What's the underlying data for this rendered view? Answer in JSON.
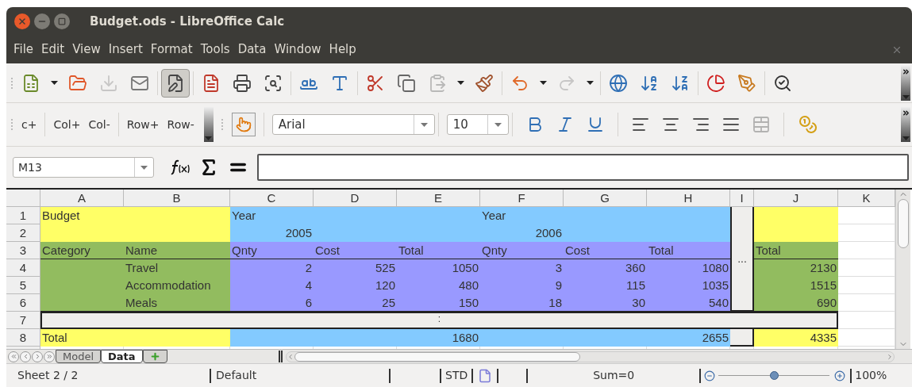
{
  "window": {
    "title": "Budget.ods - LibreOffice Calc"
  },
  "menu": [
    "File",
    "Edit",
    "View",
    "Insert",
    "Format",
    "Tools",
    "Data",
    "Window",
    "Help"
  ],
  "toolbar": [
    {
      "items": [
        {
          "kind": "new",
          "disabled": false,
          "on": false
        },
        {
          "kind": "caret",
          "disabled": false,
          "on": false
        },
        {
          "kind": "open",
          "disabled": false,
          "on": false
        },
        {
          "kind": "save",
          "disabled": true,
          "on": false
        },
        {
          "kind": "mail",
          "disabled": false,
          "on": false
        }
      ]
    },
    {
      "items": [
        {
          "kind": "edit",
          "disabled": false,
          "on": true
        }
      ]
    },
    {
      "items": [
        {
          "kind": "pdf",
          "disabled": false,
          "on": false
        },
        {
          "kind": "print",
          "disabled": false,
          "on": false
        },
        {
          "kind": "preview",
          "disabled": false,
          "on": false
        }
      ]
    },
    {
      "items": [
        {
          "kind": "spell",
          "disabled": false,
          "on": false
        },
        {
          "kind": "autospell",
          "disabled": false,
          "on": false
        }
      ]
    },
    {
      "items": [
        {
          "kind": "cut",
          "disabled": false,
          "on": false
        },
        {
          "kind": "copy",
          "disabled": false,
          "on": false
        },
        {
          "kind": "paste",
          "disabled": true,
          "on": false
        },
        {
          "kind": "caret",
          "disabled": false,
          "on": false
        },
        {
          "kind": "brush",
          "disabled": false,
          "on": false
        }
      ]
    },
    {
      "items": [
        {
          "kind": "undo",
          "disabled": false,
          "on": false
        },
        {
          "kind": "caret",
          "disabled": false,
          "on": false
        },
        {
          "kind": "redo",
          "disabled": true,
          "on": false
        },
        {
          "kind": "caret",
          "disabled": false,
          "on": false
        }
      ]
    },
    {
      "items": [
        {
          "kind": "navigator",
          "disabled": false,
          "on": false
        },
        {
          "kind": "sort-asc",
          "disabled": false,
          "on": false
        },
        {
          "kind": "sort-desc",
          "disabled": false,
          "on": false
        }
      ]
    },
    {
      "items": [
        {
          "kind": "chart",
          "disabled": false,
          "on": false
        },
        {
          "kind": "draw",
          "disabled": false,
          "on": false
        }
      ]
    },
    {
      "items": [
        {
          "kind": "find",
          "disabled": false,
          "on": false
        }
      ]
    }
  ],
  "toolbar2": {
    "groups": [
      [
        "c+"
      ],
      [
        "Col+",
        "Col-"
      ],
      [
        "Row+",
        "Row-"
      ]
    ],
    "font": "Arial",
    "size": "10",
    "format": [
      {
        "kind": "bold",
        "disabled": false
      },
      {
        "kind": "italic",
        "disabled": false
      },
      {
        "kind": "underline",
        "disabled": false
      }
    ],
    "align": [
      {
        "kind": "left",
        "disabled": false
      },
      {
        "kind": "center",
        "disabled": false
      },
      {
        "kind": "right",
        "disabled": false
      },
      {
        "kind": "justify",
        "disabled": false
      },
      {
        "kind": "merge",
        "disabled": true
      }
    ]
  },
  "formula_bar": {
    "cell": "M13"
  },
  "sheet": {
    "columns": [
      "A",
      "B",
      "C",
      "D",
      "E",
      "F",
      "G",
      "H",
      "I",
      "J",
      "K"
    ],
    "collapsed_column": {
      "text": "..."
    },
    "rows": [
      {
        "label": "1",
        "kind": "data",
        "cells": [
          {
            "kind": "text",
            "text": "Budget",
            "color": "#ffff66"
          },
          {
            "kind": "text",
            "color": "#ffff66"
          },
          {
            "kind": "text",
            "text": "Year",
            "color": "#83caff"
          },
          {
            "kind": "text",
            "color": "#83caff"
          },
          {
            "kind": "text",
            "color": "#83caff"
          },
          {
            "kind": "text",
            "text": "Year",
            "color": "#83caff"
          },
          {
            "kind": "text",
            "color": "#83caff"
          },
          {
            "kind": "text",
            "color": "#83caff"
          },
          {
            "kind": "text",
            "color": "#ffff66"
          },
          {
            "kind": "text"
          }
        ]
      },
      {
        "label": "2",
        "kind": "data",
        "cells": [
          {
            "kind": "text",
            "color": "#ffff66"
          },
          {
            "kind": "text",
            "color": "#ffff66"
          },
          {
            "kind": "number",
            "text": "2005",
            "color": "#83caff"
          },
          {
            "kind": "text",
            "color": "#83caff"
          },
          {
            "kind": "text",
            "color": "#83caff"
          },
          {
            "kind": "number",
            "text": "2006",
            "color": "#83caff"
          },
          {
            "kind": "text",
            "color": "#83caff"
          },
          {
            "kind": "text",
            "color": "#83caff"
          },
          {
            "kind": "text",
            "color": "#ffff66"
          },
          {
            "kind": "text"
          }
        ]
      },
      {
        "label": "3",
        "kind": "data",
        "cells": [
          {
            "kind": "text",
            "text": "Category",
            "color": "#92bc5f"
          },
          {
            "kind": "text",
            "text": "Name",
            "color": "#92bc5f"
          },
          {
            "kind": "text",
            "text": "Qnty",
            "color": "#9999ff"
          },
          {
            "kind": "text",
            "text": "Cost",
            "color": "#9999ff"
          },
          {
            "kind": "text",
            "text": "Total",
            "color": "#9999ff"
          },
          {
            "kind": "text",
            "text": "Qnty",
            "color": "#9999ff"
          },
          {
            "kind": "text",
            "text": "Cost",
            "color": "#9999ff"
          },
          {
            "kind": "text",
            "text": "Total",
            "color": "#9999ff"
          },
          {
            "kind": "text",
            "text": "Total",
            "color": "#92bc5f"
          },
          {
            "kind": "text"
          }
        ]
      },
      {
        "label": "4",
        "kind": "data",
        "cells": [
          {
            "kind": "text",
            "color": "#92bc5f"
          },
          {
            "kind": "text",
            "text": "Travel",
            "color": "#92bc5f"
          },
          {
            "kind": "number",
            "text": "2",
            "color": "#9999ff"
          },
          {
            "kind": "number",
            "text": "525",
            "color": "#9999ff"
          },
          {
            "kind": "number",
            "text": "1050",
            "color": "#9999ff"
          },
          {
            "kind": "number",
            "text": "3",
            "color": "#9999ff"
          },
          {
            "kind": "number",
            "text": "360",
            "color": "#9999ff"
          },
          {
            "kind": "number",
            "text": "1080",
            "color": "#9999ff"
          },
          {
            "kind": "number",
            "text": "2130",
            "color": "#92bc5f"
          },
          {
            "kind": "text"
          }
        ]
      },
      {
        "label": "5",
        "kind": "data",
        "cells": [
          {
            "kind": "text",
            "color": "#92bc5f"
          },
          {
            "kind": "text",
            "text": "Accommodation",
            "color": "#92bc5f"
          },
          {
            "kind": "number",
            "text": "4",
            "color": "#9999ff"
          },
          {
            "kind": "number",
            "text": "120",
            "color": "#9999ff"
          },
          {
            "kind": "number",
            "text": "480",
            "color": "#9999ff"
          },
          {
            "kind": "number",
            "text": "9",
            "color": "#9999ff"
          },
          {
            "kind": "number",
            "text": "115",
            "color": "#9999ff"
          },
          {
            "kind": "number",
            "text": "1035",
            "color": "#9999ff"
          },
          {
            "kind": "number",
            "text": "1515",
            "color": "#92bc5f"
          },
          {
            "kind": "text"
          }
        ]
      },
      {
        "label": "6",
        "kind": "data",
        "cells": [
          {
            "kind": "text",
            "color": "#92bc5f"
          },
          {
            "kind": "text",
            "text": "Meals",
            "color": "#92bc5f"
          },
          {
            "kind": "number",
            "text": "6",
            "color": "#9999ff"
          },
          {
            "kind": "number",
            "text": "25",
            "color": "#9999ff"
          },
          {
            "kind": "number",
            "text": "150",
            "color": "#9999ff"
          },
          {
            "kind": "number",
            "text": "18",
            "color": "#9999ff"
          },
          {
            "kind": "number",
            "text": "30",
            "color": "#9999ff"
          },
          {
            "kind": "number",
            "text": "540",
            "color": "#9999ff"
          },
          {
            "kind": "number",
            "text": "690",
            "color": "#92bc5f"
          },
          {
            "kind": "text"
          }
        ]
      },
      {
        "label": "7",
        "kind": "collapsed",
        "text": ":"
      },
      {
        "label": "8",
        "kind": "data",
        "cells": [
          {
            "kind": "text",
            "text": "Total",
            "color": "#ffff66"
          },
          {
            "kind": "text",
            "color": "#ffff66"
          },
          {
            "kind": "text",
            "color": "#83caff"
          },
          {
            "kind": "text",
            "color": "#83caff"
          },
          {
            "kind": "number",
            "text": "1680",
            "color": "#83caff"
          },
          {
            "kind": "text",
            "color": "#83caff"
          },
          {
            "kind": "text",
            "color": "#83caff"
          },
          {
            "kind": "number",
            "text": "2655",
            "color": "#83caff"
          },
          {
            "kind": "number",
            "text": "4335",
            "color": "#ffff66"
          },
          {
            "kind": "text"
          }
        ]
      }
    ]
  },
  "sheet_tabs": {
    "tabs": [
      {
        "label": "Model",
        "selected": false
      },
      {
        "label": "Data",
        "selected": true
      }
    ]
  },
  "status_bar": {
    "sheet": "Sheet 2 / 2",
    "style": "Default",
    "mode": "STD",
    "sum": "Sum=0",
    "zoom": {
      "level": 0.5,
      "reading": "100%"
    }
  }
}
